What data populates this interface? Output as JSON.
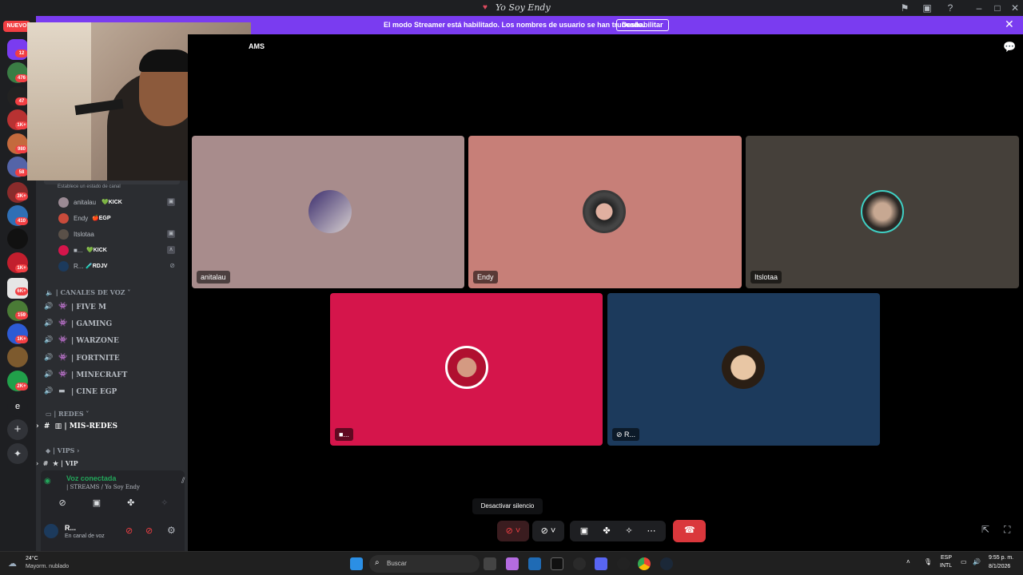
{
  "window": {
    "title": "Yo Soy Endy"
  },
  "banner": {
    "message": "El modo Streamer está habilitado. Los nombres de usuario se han truncado.",
    "disable_label": "Deshabilitar"
  },
  "rail": {
    "new_label": "NUEVO",
    "badges": [
      "12",
      "476",
      "47",
      "1K+",
      "980",
      "58",
      "3K+",
      "410",
      "1K+",
      "6K+",
      "159",
      "1K+",
      "2K+"
    ],
    "e_label": "e"
  },
  "header": {
    "channel_fragment": "AMS"
  },
  "sidebar": {
    "status_hint": "Establece un estado de canal",
    "members": [
      {
        "name": "anitalau",
        "tag": "KICK",
        "tag_prefix": "💚",
        "indicator": "▣"
      },
      {
        "name": "Endy",
        "tag": "EGP",
        "tag_prefix": "🍎",
        "indicator": ""
      },
      {
        "name": "Itslotaa",
        "tag": "",
        "tag_prefix": "",
        "indicator": "▣"
      },
      {
        "name": "■...",
        "tag": "KICK",
        "tag_prefix": "💚",
        "indicator": "∧"
      },
      {
        "name": "R...",
        "tag": "RDJV",
        "tag_prefix": "🧪",
        "indicator": ""
      }
    ],
    "voice_section": "| CANALES DE VOZ",
    "voice_channels": [
      "| FIVE M",
      "| GAMING",
      "| WARZONE",
      "| FORTNITE",
      "| MINECRAFT",
      "| CINE EGP"
    ],
    "redes_section": "| REDES",
    "mis_redes": "| MIS-REDES",
    "vips_section": "| VIPS",
    "vip": "| VIP",
    "voice_connected": "Voz conectada",
    "voice_location": "| STREAMS / Yo Soy Endy",
    "user_name": "R...",
    "user_status": "En canal de voz"
  },
  "stage": {
    "tiles": [
      {
        "name": "anitalau",
        "color": "#a88c8c"
      },
      {
        "name": "Endy",
        "color": "#c77f78"
      },
      {
        "name": "Itslotaa",
        "color": "#45403a"
      },
      {
        "name": "■...",
        "color": "#d5154b"
      },
      {
        "name": "R...",
        "color": "#1c3a5c"
      }
    ]
  },
  "controls": {
    "tooltip": "Desactivar silencio"
  },
  "taskbar": {
    "weather_temp": "24°C",
    "weather_desc": "Mayorm. nublado",
    "search_placeholder": "Buscar",
    "lang_top": "ESP",
    "lang_bottom": "INTL",
    "time": "9:55 p. m.",
    "date": "8/1/2026"
  }
}
